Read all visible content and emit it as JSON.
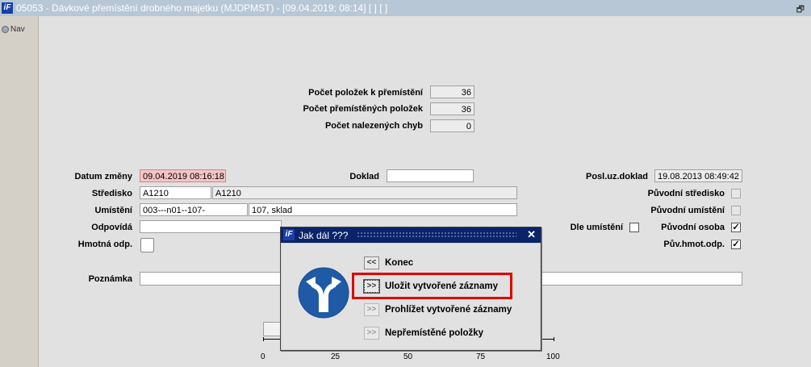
{
  "window": {
    "title": "05053 - Dávkové přemístění drobného majetku (MJDPMST) - [09.04.2019; 08:14]  [ ]  [ ]",
    "logo_text": "iF",
    "restore_glyph": "🗗",
    "close_glyph": "✕"
  },
  "nav": {
    "label": "Nav"
  },
  "counters": {
    "to_move": {
      "label": "Počet položek k přemístění",
      "value": "36"
    },
    "moved": {
      "label": "Počet přemístěných položek",
      "value": "36"
    },
    "errors": {
      "label": "Počet nalezených chyb",
      "value": "0"
    }
  },
  "form": {
    "datum_zmeny": {
      "label": "Datum změny",
      "value": "09.04.2019 08:16:18"
    },
    "doklad": {
      "label": "Doklad",
      "value": ""
    },
    "posl_uz_doklad": {
      "label": "Posl.uz.doklad",
      "value": "19.08.2013 08:49:42"
    },
    "stredisko": {
      "label": "Středisko",
      "code": "A1210",
      "name": "A1210"
    },
    "puvodni_stredisko": {
      "label": "Původní středisko"
    },
    "umisteni": {
      "label": "Umístění",
      "code": "003---n01--107-",
      "name": "107, sklad"
    },
    "puvodni_umisteni": {
      "label": "Původní umístění"
    },
    "odpovida": {
      "label": "Odpovídá",
      "value": ""
    },
    "dle_umisteni": {
      "label": "Dle umístění"
    },
    "puvodni_osoba": {
      "label": "Původní osoba",
      "checked": true
    },
    "hmotna_odp": {
      "label": "Hmotná odp."
    },
    "puv_hmot_odp": {
      "label": "Pův.hmot.odp.",
      "checked": true
    },
    "poznamka": {
      "label": "Poznámka",
      "value": ""
    }
  },
  "check_glyph": "✓",
  "scale": {
    "ticks": [
      "0",
      "25",
      "50",
      "75",
      "100"
    ]
  },
  "dialog": {
    "title": "Jak dál ???",
    "icon": "split-direction-arrow-icon",
    "options": [
      {
        "button": "<<",
        "label": "Konec"
      },
      {
        "button": ">>",
        "label": "Uložit vytvořené záznamy"
      },
      {
        "button": ">>",
        "label": "Prohlížet vytvořené záznamy"
      },
      {
        "button": ">>",
        "label": "Nepřemístěné položky"
      }
    ]
  },
  "colors": {
    "title_bar": "#b8c7d6",
    "dialog_title": "#0a246a",
    "date_field": "#f6c4c4",
    "highlight": "#e00000",
    "icon_blue": "#1f5aa6"
  }
}
